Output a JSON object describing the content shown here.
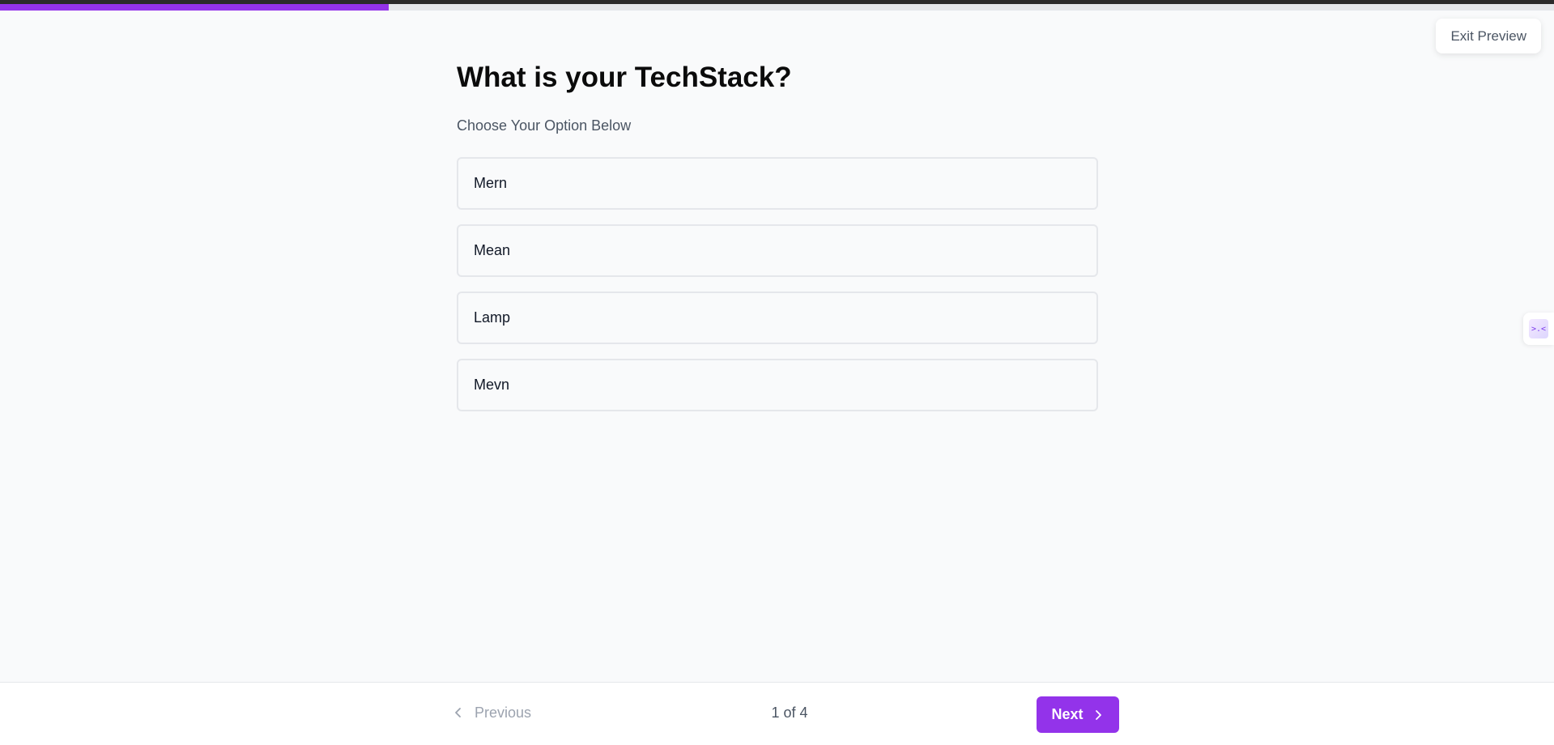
{
  "progress": {
    "fraction": 0.25,
    "accent_color": "#9333ea"
  },
  "header": {
    "exit_label": "Exit Preview"
  },
  "question": {
    "title": "What is your TechStack?",
    "subtitle": "Choose Your Option Below",
    "options": [
      {
        "label": "Mern"
      },
      {
        "label": "Mean"
      },
      {
        "label": "Lamp"
      },
      {
        "label": "Mevn"
      }
    ]
  },
  "footer": {
    "previous_label": "Previous",
    "page_indicator": "1 of 4",
    "next_label": "Next"
  },
  "side_widget": {
    "icon": "code-chat-icon",
    "glyph": ">.<"
  }
}
